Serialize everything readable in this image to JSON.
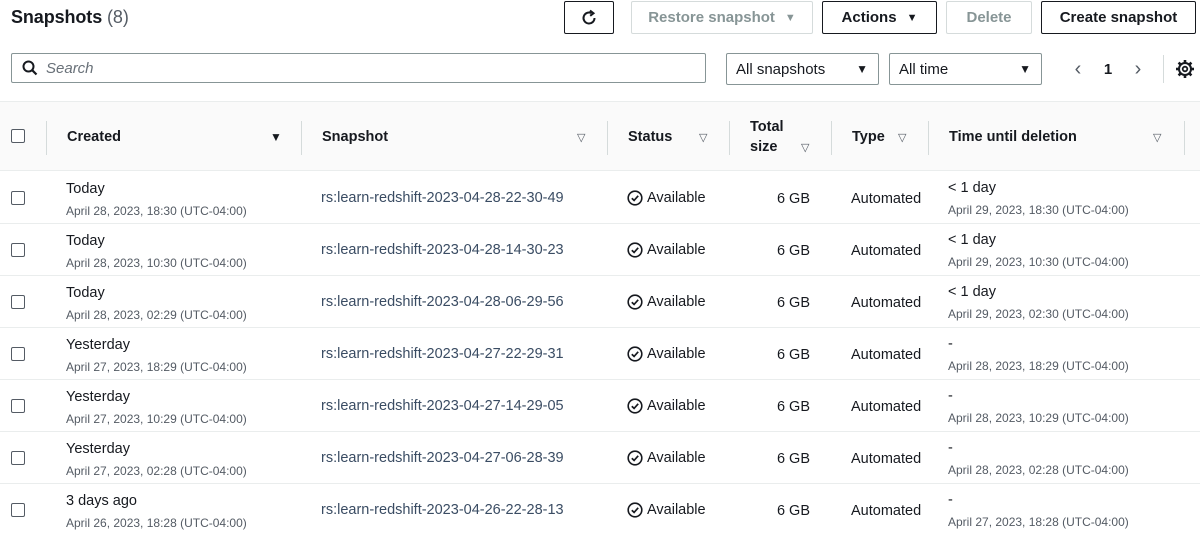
{
  "header": {
    "title": "Snapshots",
    "count": "(8)",
    "restore_label": "Restore snapshot",
    "actions_label": "Actions",
    "delete_label": "Delete",
    "create_label": "Create snapshot"
  },
  "filters": {
    "search_placeholder": "Search",
    "snapshot_filter": "All snapshots",
    "time_filter": "All time",
    "page": "1"
  },
  "table": {
    "columns": {
      "created": "Created",
      "snapshot": "Snapshot",
      "status": "Status",
      "total_size_1": "Total",
      "total_size_2": "size",
      "type": "Type",
      "time_until_deletion": "Time until deletion"
    },
    "rows": [
      {
        "created": "Today",
        "created_date": "April 28, 2023, 18:30 (UTC-04:00)",
        "snapshot": "rs:learn-redshift-2023-04-28-22-30-49",
        "status": "Available",
        "size": "6 GB",
        "type": "Automated",
        "deletion": "< 1 day",
        "deletion_date": "April 29, 2023, 18:30 (UTC-04:00)"
      },
      {
        "created": "Today",
        "created_date": "April 28, 2023, 10:30 (UTC-04:00)",
        "snapshot": "rs:learn-redshift-2023-04-28-14-30-23",
        "status": "Available",
        "size": "6 GB",
        "type": "Automated",
        "deletion": "< 1 day",
        "deletion_date": "April 29, 2023, 10:30 (UTC-04:00)"
      },
      {
        "created": "Today",
        "created_date": "April 28, 2023, 02:29 (UTC-04:00)",
        "snapshot": "rs:learn-redshift-2023-04-28-06-29-56",
        "status": "Available",
        "size": "6 GB",
        "type": "Automated",
        "deletion": "< 1 day",
        "deletion_date": "April 29, 2023, 02:30 (UTC-04:00)"
      },
      {
        "created": "Yesterday",
        "created_date": "April 27, 2023, 18:29 (UTC-04:00)",
        "snapshot": "rs:learn-redshift-2023-04-27-22-29-31",
        "status": "Available",
        "size": "6 GB",
        "type": "Automated",
        "deletion": "-",
        "deletion_date": "April 28, 2023, 18:29 (UTC-04:00)"
      },
      {
        "created": "Yesterday",
        "created_date": "April 27, 2023, 10:29 (UTC-04:00)",
        "snapshot": "rs:learn-redshift-2023-04-27-14-29-05",
        "status": "Available",
        "size": "6 GB",
        "type": "Automated",
        "deletion": "-",
        "deletion_date": "April 28, 2023, 10:29 (UTC-04:00)"
      },
      {
        "created": "Yesterday",
        "created_date": "April 27, 2023, 02:28 (UTC-04:00)",
        "snapshot": "rs:learn-redshift-2023-04-27-06-28-39",
        "status": "Available",
        "size": "6 GB",
        "type": "Automated",
        "deletion": "-",
        "deletion_date": "April 28, 2023, 02:28 (UTC-04:00)"
      },
      {
        "created": "3 days ago",
        "created_date": "April 26, 2023, 18:28 (UTC-04:00)",
        "snapshot": "rs:learn-redshift-2023-04-26-22-28-13",
        "status": "Available",
        "size": "6 GB",
        "type": "Automated",
        "deletion": "-",
        "deletion_date": "April 27, 2023, 18:28 (UTC-04:00)"
      }
    ]
  },
  "icons": {
    "refresh": "refresh-icon",
    "search": "search-icon",
    "settings": "gear-icon",
    "status": "check-circle-icon"
  }
}
